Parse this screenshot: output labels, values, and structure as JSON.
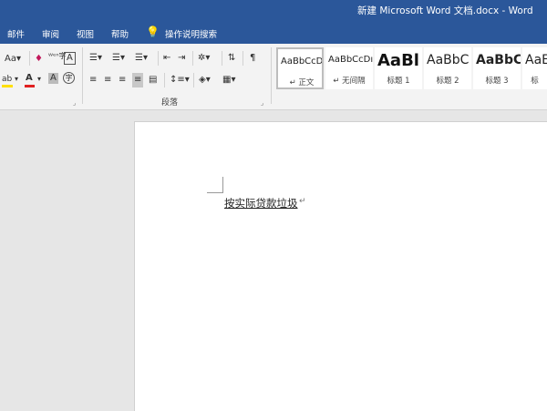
{
  "window": {
    "title": "新建 Microsoft Word 文档.docx  -  Word"
  },
  "menu": {
    "items": [
      "邮件",
      "审阅",
      "视图",
      "帮助"
    ],
    "tell_me": "操作说明搜索"
  },
  "ribbon": {
    "font_group": {
      "change_case": "Aa",
      "clear_format": "♦",
      "phonetic": "ᵂᵉⁿ字",
      "char_border": "A",
      "highlight": "ab",
      "font_color": "A",
      "char_shading": "A",
      "enclose": "字"
    },
    "paragraph_group": {
      "label": "段落"
    },
    "styles": [
      {
        "preview": "AaBbCcDı",
        "name": "↵ 正文"
      },
      {
        "preview": "AaBbCcDı",
        "name": "↵ 无间隔"
      },
      {
        "preview": "AaBl",
        "name": "标题 1"
      },
      {
        "preview": "AaBbC",
        "name": "标题 2"
      },
      {
        "preview": "AaBbC",
        "name": "标题 3"
      },
      {
        "preview": "AaE",
        "name": "标"
      }
    ]
  },
  "document": {
    "text": "按实际贷款垃圾",
    "para_mark": "↵"
  },
  "colors": {
    "accent": "#2b579a",
    "font_color_bar": "#e02020",
    "highlight_bar": "#ffe000"
  }
}
